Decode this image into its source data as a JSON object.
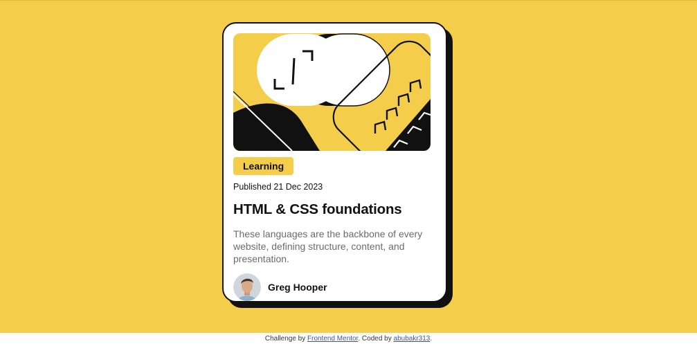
{
  "card": {
    "tag": "Learning",
    "published": "Published 21 Dec 2023",
    "title": "HTML & CSS foundations",
    "description": "These languages are the backbone of every website, defining structure, content, and presentation.",
    "author": "Greg Hooper"
  },
  "footer": {
    "prefix": "Challenge by ",
    "link1": "Frontend Mentor",
    "middle": ". Coded by ",
    "link2": "abubakr313",
    "suffix": "."
  },
  "colors": {
    "background": "#f4ce4b",
    "card": "#ffffff",
    "ink": "#111111",
    "muted": "#6b6b6b",
    "link": "#3e52a3"
  },
  "icons": {
    "hero": "abstract-illustration",
    "avatar": "author-portrait"
  }
}
